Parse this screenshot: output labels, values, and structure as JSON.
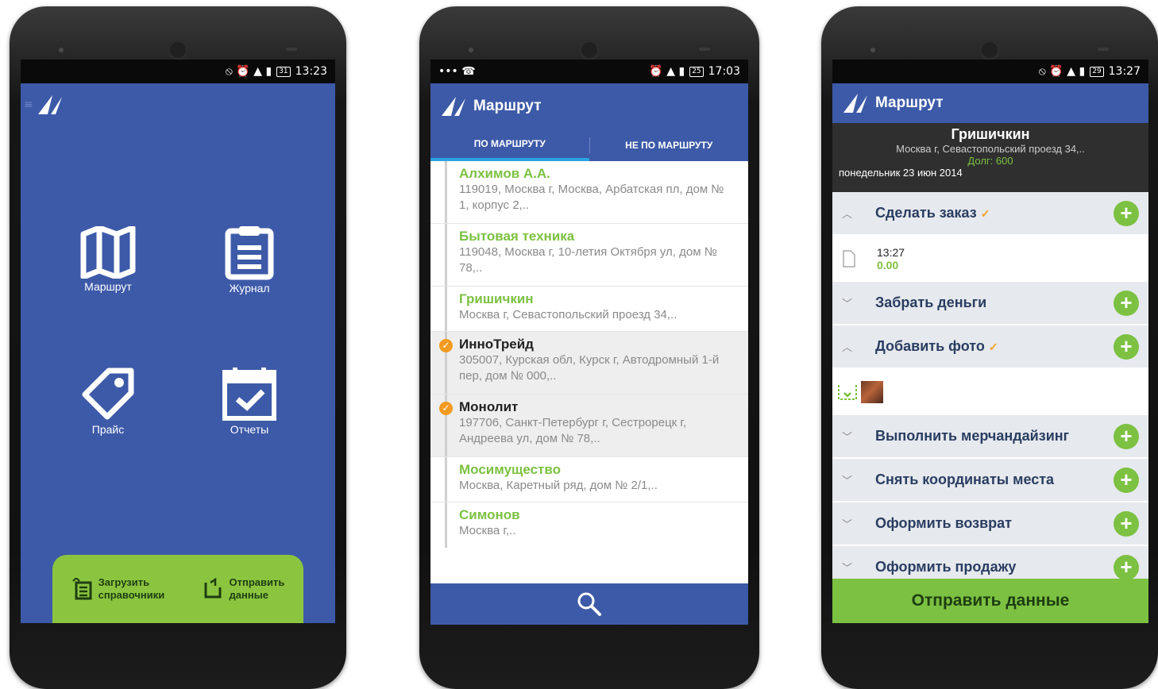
{
  "colors": {
    "brand_blue": "#3d5aa8",
    "accent_green": "#7cc142",
    "warning_orange": "#f29b20"
  },
  "phone1": {
    "status": {
      "time": "13:23",
      "battery": "31"
    },
    "tiles": [
      {
        "label": "Маршрут",
        "icon": "map-icon"
      },
      {
        "label": "Журнал",
        "icon": "clipboard-icon"
      },
      {
        "label": "Прайс",
        "icon": "price-tag-icon"
      },
      {
        "label": "Отчеты",
        "icon": "calendar-check-icon"
      }
    ],
    "bottom": {
      "load_line1": "Загрузить",
      "load_line2": "справочники",
      "send_line1": "Отправить",
      "send_line2": "данные"
    }
  },
  "phone2": {
    "status": {
      "time": "17:03",
      "battery": "25"
    },
    "title": "Маршрут",
    "tabs": {
      "on_route": "ПО МАРШРУТУ",
      "off_route": "НЕ ПО МАРШРУТУ"
    },
    "clients": [
      {
        "name": "Алхимов А.А.",
        "address": "119019, Москва г, Москва, Арбатская пл, дом № 1, корпус 2,..",
        "visited": true
      },
      {
        "name": "Бытовая техника",
        "address": "119048, Москва г, 10-летия Октября ул, дом № 78,..",
        "visited": true
      },
      {
        "name": "Гришичкин",
        "address": "Москва г, Севастопольский проезд 34,..",
        "visited": true
      },
      {
        "name": "ИнноТрейд",
        "address": "305007, Курская обл, Курск г, Автодромный 1-й пер, дом № 000,..",
        "visited": false
      },
      {
        "name": "Монолит",
        "address": "197706, Санкт-Петербург г, Сестрорецк г, Андреева ул, дом № 78,..",
        "visited": false
      },
      {
        "name": "Мосимущество",
        "address": "Москва, Каретный ряд, дом № 2/1,..",
        "visited": true
      },
      {
        "name": "Симонов",
        "address": "Москва г,..",
        "visited": true
      }
    ]
  },
  "phone3": {
    "status": {
      "time": "13:27",
      "battery": "29"
    },
    "title": "Маршрут",
    "client": {
      "name": "Гришичкин",
      "address": "Москва г, Севастопольский проезд 34,..",
      "debt": "Долг: 600",
      "date": "понедельник 23 июн 2014"
    },
    "order_entry": {
      "time": "13:27",
      "amount": "0.00"
    },
    "actions": {
      "make_order": "Сделать заказ",
      "collect_money": "Забрать деньги",
      "add_photo": "Добавить фото",
      "merchandising": "Выполнить мерчандайзинг",
      "coordinates": "Снять координаты места",
      "return": "Оформить возврат",
      "sale": "Оформить продажу"
    },
    "send_button": "Отправить данные"
  }
}
